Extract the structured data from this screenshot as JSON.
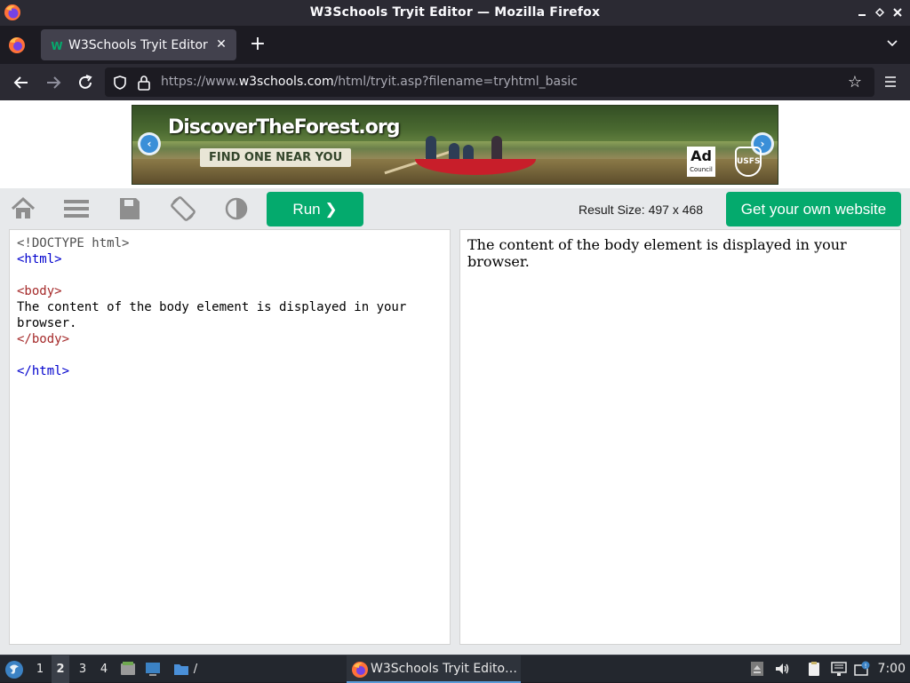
{
  "window": {
    "title": "W3Schools Tryit Editor — Mozilla Firefox"
  },
  "tabs": [
    {
      "label": "W3Schools Tryit Editor",
      "active": true
    }
  ],
  "navbar": {
    "url_prefix": "https://www.",
    "url_domain": "w3schools.com",
    "url_path": "/html/tryit.asp?filename=tryhtml_basic"
  },
  "ad": {
    "headline": "DiscoverTheForest.org",
    "cta": "FIND ONE NEAR YOU",
    "adcouncil_top": "Ad",
    "adcouncil_bottom": "Council",
    "usfs": "USFS"
  },
  "toolbar": {
    "run_label": "Run ❯",
    "result_size_label": "Result Size: 497 x 468",
    "own_site_label": "Get your own website"
  },
  "code": {
    "line1": "<!DOCTYPE html>",
    "line2": "<html>",
    "line4": "<body>",
    "line5": "The content of the body element is displayed in your",
    "line6": "browser.",
    "line7": "</body>",
    "line9": "</html>"
  },
  "result": {
    "text": "The content of the body element is displayed in your browser."
  },
  "taskbar": {
    "workspaces": [
      "1",
      "2",
      "3",
      "4"
    ],
    "active_workspace": "2",
    "files_label": "/",
    "window_label": "W3Schools Tryit Edito…",
    "clock": "7:00"
  },
  "colors": {
    "w3_green": "#04aa6d",
    "firefox_dark": "#2b2a33"
  }
}
